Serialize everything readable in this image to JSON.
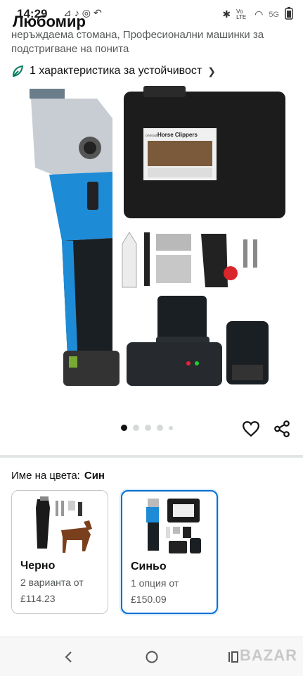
{
  "status_bar": {
    "time": "14:29",
    "overlay_name": "Любомир",
    "network": "5G",
    "volte": "Vo LTE"
  },
  "product": {
    "title_tail": "неръждаема стомана, Професионални машинки за подстригване на понита",
    "sustainability": "1 характеристика за устойчивост",
    "image_box_label": "Horse Clippers",
    "brand_tag": "oneisall"
  },
  "carousel": {
    "count": 5,
    "active_index": 0
  },
  "colors": {
    "label": "Име на цвета:",
    "selected_value": "Син",
    "variants": [
      {
        "name": "Черно",
        "options": "2 варианта от",
        "price": "£114.23",
        "selected": false
      },
      {
        "name": "Синьо",
        "options": "1 опция от",
        "price": "£150.09",
        "selected": true
      }
    ]
  },
  "watermark": "BAZAR",
  "theme": {
    "accent": "#0a6ed1",
    "clipper_blue": "#1e8bd6",
    "text_secondary": "#565959"
  }
}
